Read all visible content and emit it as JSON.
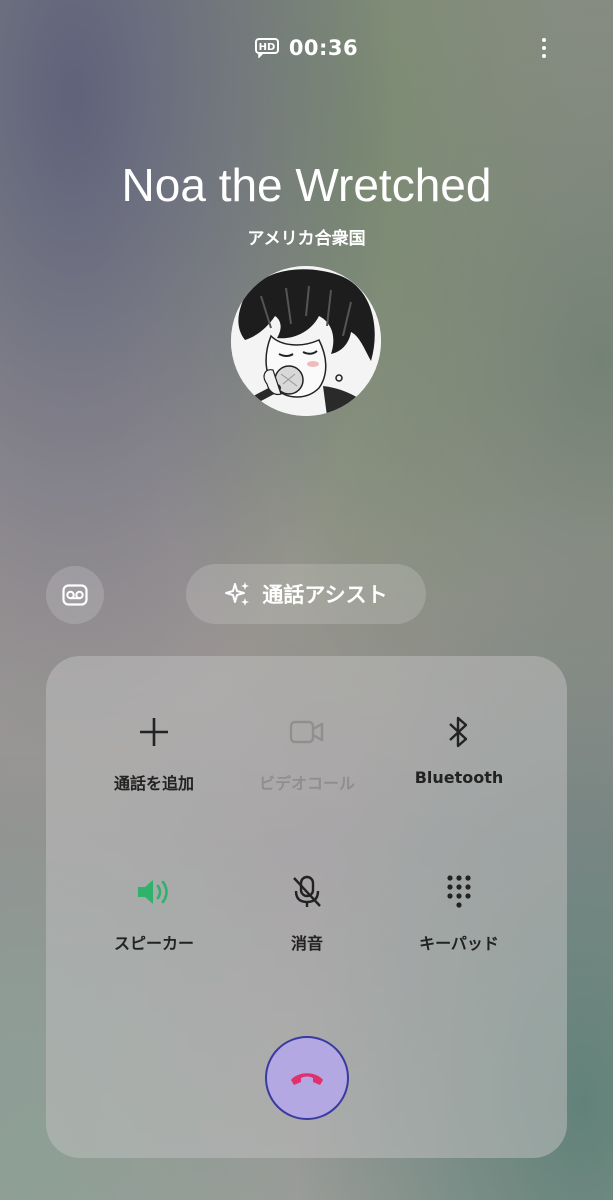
{
  "status": {
    "hd_icon": "hd-voice-icon",
    "timer": "00:36",
    "menu_icon": "more-vertical-icon"
  },
  "caller": {
    "name": "Noa the Wretched",
    "location": "アメリカ合衆国",
    "avatar_icon": "contact-avatar"
  },
  "actions": {
    "voicemail_icon": "voicemail-icon",
    "assist_label": "通話アシスト",
    "assist_icon": "sparkle-icon"
  },
  "controls": [
    {
      "label": "通話を追加",
      "icon": "plus-icon",
      "enabled": true
    },
    {
      "label": "ビデオコール",
      "icon": "video-icon",
      "enabled": false
    },
    {
      "label": "Bluetooth",
      "icon": "bluetooth-icon",
      "enabled": true
    },
    {
      "label": "スピーカー",
      "icon": "speaker-icon",
      "enabled": true,
      "active": true
    },
    {
      "label": "消音",
      "icon": "mic-off-icon",
      "enabled": true
    },
    {
      "label": "キーパッド",
      "icon": "keypad-icon",
      "enabled": true
    }
  ],
  "end_call": {
    "icon": "end-call-icon"
  },
  "colors": {
    "speaker_active": "#2fb36b",
    "end_call_bg": "#b3a8e2",
    "end_call_icon": "#e0306e",
    "disabled": "#8f8f8f"
  }
}
